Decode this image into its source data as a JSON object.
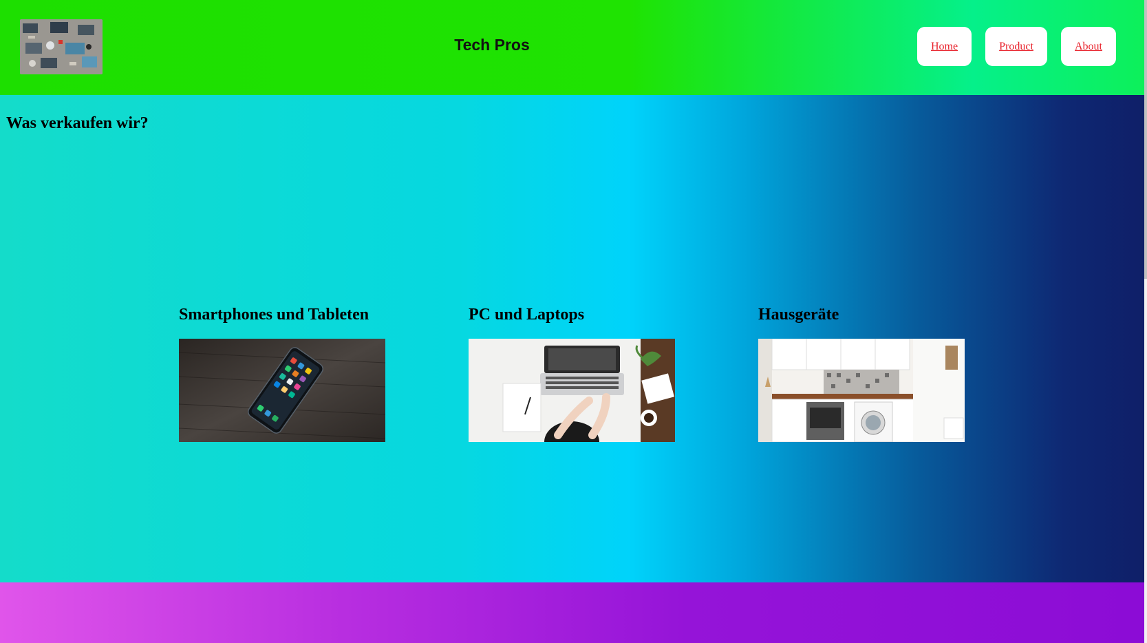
{
  "header": {
    "brand": "Tech Pros",
    "nav": {
      "home": "Home",
      "product": "Product",
      "about": "About"
    }
  },
  "main": {
    "section_title": "Was verkaufen wir?",
    "categories": [
      {
        "title": "Smartphones und Tableten"
      },
      {
        "title": "PC und Laptops"
      },
      {
        "title": "Hausgeräte"
      }
    ]
  },
  "colors": {
    "header_start": "#1ddf00",
    "header_end": "#0df05a",
    "main_start": "#14dcca",
    "main_mid": "#00d3fb",
    "main_end": "#0f1f68",
    "footer_start": "#e055ea",
    "footer_end": "#8c0cd6",
    "nav_link": "#e8202a"
  }
}
